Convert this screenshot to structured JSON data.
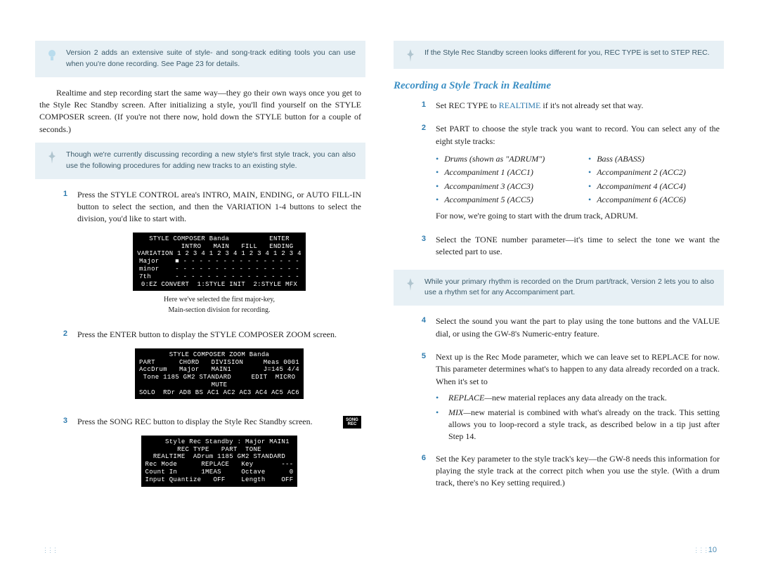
{
  "left": {
    "tip1": "Version 2 adds an extensive suite of style- and song-track editing tools you can use when you're done recording. See Page 23 for details.",
    "para1": "Realtime and step recording start the same way—they go their own ways once you get to the Style Rec Standby screen. After initializing a style, you'll find yourself on the STYLE COMPOSER screen. (If you're not there now, hold down the STYLE button for a couple of seconds.)",
    "tip2": "Though we're currently discussing recording a new style's first style track, you can also use the following procedures for adding new tracks to an existing style.",
    "step1": "Press the STYLE CONTROL area's INTRO, MAIN, ENDING, or AUTO FILL-IN button to select the section, and then the VARIATION 1-4 buttons to select the division, you'd like to start with.",
    "lcd1": "STYLE COMPOSER Banda          ENTER\n         INTRO   MAIN   FILL   ENDING\nVARIATION 1 2 3 4 1 2 3 4 1 2 3 4 1 2 3 4\nMajor    ■ - - - - - - - - - - - - - - -\nminor    - - - - - - - - - - - - - - - -\n7th      - - - - - - - - - - - - - - - -\n0:EZ CONVERT  1:STYLE INIT  2:STYLE MFX",
    "caption1a": "Here we've selected the first major-key,",
    "caption1b": "Main-section division for recording.",
    "step2": "Press the ENTER button to display the STYLE COMPOSER ZOOM screen.",
    "lcd2": "STYLE COMPOSER ZOOM Banda\nPART      CHORD   DIVISION     Meas 0001\nAccDrum   Major   MAIN1        J=145 4/4\nTone 1185 GM2 STANDARD     EDIT  MICRO\nMUTE\nSOLO  RDr AD8 BS AC1 AC2 AC3 AC4 AC5 AC6",
    "step3": "Press the SONG REC button to display the Style Rec Standby screen.",
    "song_rec": "SONG\nREC",
    "lcd3": "    Style Rec Standby : Major MAIN1\nREC TYPE   PART  TONE\nREALTIME  ADrum 1185 GM2 STANDARD\nRec Mode      REPLACE   Key       ---\nCount In      1MEAS     Octave      0\nInput Quantize   OFF    Length    OFF"
  },
  "right": {
    "tip1": "If the Style Rec Standby screen looks different for you, REC TYPE is set to STEP REC.",
    "heading": "Recording a Style Track in Realtime",
    "s1a": "Set REC TYPE to ",
    "s1b": "REALTIME",
    "s1c": " if it's not already set that way.",
    "s2": "Set PART to choose the style track you want to record. You can select any of the eight style tracks:",
    "bl": {
      "a": "Drums (shown as \"ADRUM\")",
      "b": "Accompaniment 1 (ACC1)",
      "c": "Accompaniment 3 (ACC3)",
      "d": "Accompaniment 5 (ACC5)"
    },
    "br": {
      "a": "Bass (ABASS)",
      "b": "Accompaniment 2 (ACC2)",
      "c": "Accompaniment 4 (ACC4)",
      "d": "Accompaniment 6 (ACC6)"
    },
    "s2_after": "For now, we're going to start with the drum track, ADRUM.",
    "s3": "Select the TONE number parameter—it's time to select the tone we want the selected part to use.",
    "tip2": "While your primary rhythm is recorded on the Drum part/track, Version 2 lets you to also use a rhythm set for any Accompaniment part.",
    "s4": "Select the sound you want the part to play using the tone buttons and the VALUE dial, or using the GW-8's Numeric-entry feature.",
    "s5": "Next up is the Rec Mode parameter, which we can leave set to REPLACE for now. This parameter determines what's to happen to any data already recorded on a track. When it's set to",
    "rep_label": "REPLACE—",
    "rep_text": "new material replaces any data already on the track.",
    "mix_label": "MIX—",
    "mix_text": "new material is combined with what's already on the track. This setting allows you to loop-record a style track, as described below in a tip just after Step 14.",
    "s6": "Set the Key parameter to the style track's key—the GW-8 needs this information for playing the style track at the correct pitch when you use the style. (With a drum track, there's no Key setting required.)"
  },
  "footer": {
    "page": "10"
  }
}
